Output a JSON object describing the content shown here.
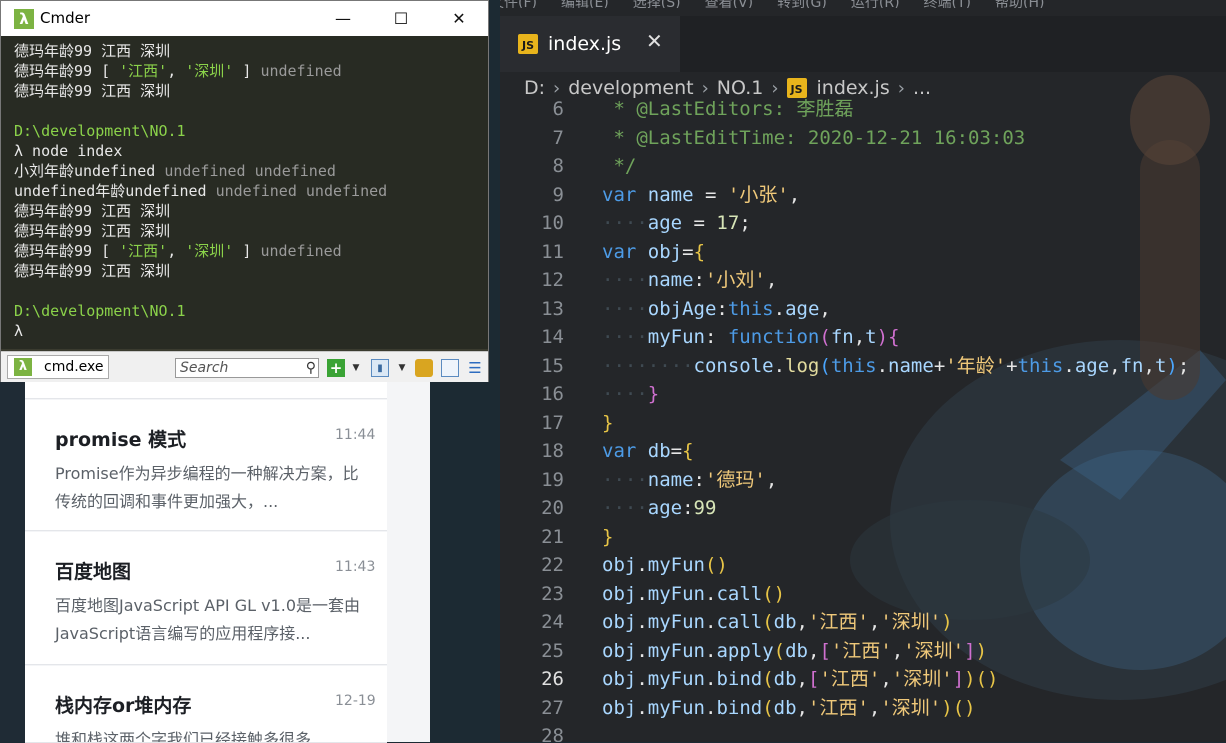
{
  "cmder": {
    "title": "Cmder",
    "minimize": "—",
    "maximize": "☐",
    "close": "✕",
    "tab_label": "cmd.exe",
    "search_placeholder": "Search",
    "console_lines": [
      [
        {
          "t": "德玛年龄99 江西 深圳",
          "c": ""
        }
      ],
      [
        {
          "t": "德玛年龄99 [ ",
          "c": ""
        },
        {
          "t": "'江西'",
          "c": "cg"
        },
        {
          "t": ", ",
          "c": ""
        },
        {
          "t": "'深圳'",
          "c": "cg"
        },
        {
          "t": " ] ",
          "c": ""
        },
        {
          "t": "undefined",
          "c": "cu"
        }
      ],
      [
        {
          "t": "德玛年龄99 江西 深圳",
          "c": ""
        }
      ],
      [
        {
          "t": "",
          "c": ""
        }
      ],
      [
        {
          "t": "D:\\development\\NO.1",
          "c": "cpath"
        }
      ],
      [
        {
          "t": "λ node index",
          "c": ""
        }
      ],
      [
        {
          "t": "小刘年龄undefined ",
          "c": ""
        },
        {
          "t": "undefined undefined",
          "c": "cu"
        }
      ],
      [
        {
          "t": "undefined年龄undefined ",
          "c": ""
        },
        {
          "t": "undefined undefined",
          "c": "cu"
        }
      ],
      [
        {
          "t": "德玛年龄99 江西 深圳",
          "c": ""
        }
      ],
      [
        {
          "t": "德玛年龄99 江西 深圳",
          "c": ""
        }
      ],
      [
        {
          "t": "德玛年龄99 [ ",
          "c": ""
        },
        {
          "t": "'江西'",
          "c": "cg"
        },
        {
          "t": ", ",
          "c": ""
        },
        {
          "t": "'深圳'",
          "c": "cg"
        },
        {
          "t": " ] ",
          "c": ""
        },
        {
          "t": "undefined",
          "c": "cu"
        }
      ],
      [
        {
          "t": "德玛年龄99 江西 深圳",
          "c": ""
        }
      ],
      [
        {
          "t": "",
          "c": ""
        }
      ],
      [
        {
          "t": "D:\\development\\NO.1",
          "c": "cpath"
        }
      ],
      [
        {
          "t": "λ",
          "c": ""
        }
      ]
    ]
  },
  "editor": {
    "tab": {
      "name": "index.js",
      "close": "✕",
      "icon": "JS"
    },
    "breadcrumb": [
      "D:",
      "development",
      "NO.1",
      "index.js",
      "..."
    ],
    "current_line": 26,
    "code_lines": [
      {
        "n": "6",
        "segs": [
          {
            "t": " * @LastEditors: 李胜磊",
            "c": "cm"
          }
        ]
      },
      {
        "n": "7",
        "segs": [
          {
            "t": " * @LastEditTime: 2020-12-21 16:03:03",
            "c": "cm"
          }
        ]
      },
      {
        "n": "8",
        "segs": [
          {
            "t": " */",
            "c": "cm"
          }
        ]
      },
      {
        "n": "9",
        "segs": [
          {
            "t": "var",
            "c": "kw"
          },
          {
            "t": " "
          },
          {
            "t": "name",
            "c": "vr"
          },
          {
            "t": " = "
          },
          {
            "t": "'小张'",
            "c": "str"
          },
          {
            "t": ","
          }
        ]
      },
      {
        "n": "10",
        "segs": [
          {
            "t": "····",
            "c": "guide"
          },
          {
            "t": "age",
            "c": "vr"
          },
          {
            "t": " = "
          },
          {
            "t": "17",
            "c": "num"
          },
          {
            "t": ";"
          }
        ]
      },
      {
        "n": "11",
        "segs": [
          {
            "t": "var",
            "c": "kw"
          },
          {
            "t": " "
          },
          {
            "t": "obj",
            "c": "vr"
          },
          {
            "t": "="
          },
          {
            "t": "{",
            "c": "br1"
          }
        ]
      },
      {
        "n": "12",
        "segs": [
          {
            "t": "····",
            "c": "guide"
          },
          {
            "t": "name",
            "c": "vr"
          },
          {
            "t": ":"
          },
          {
            "t": "'小刘'",
            "c": "str"
          },
          {
            "t": ","
          }
        ]
      },
      {
        "n": "13",
        "segs": [
          {
            "t": "····",
            "c": "guide"
          },
          {
            "t": "objAge",
            "c": "vr"
          },
          {
            "t": ":"
          },
          {
            "t": "this",
            "c": "kw"
          },
          {
            "t": "."
          },
          {
            "t": "age",
            "c": "vr"
          },
          {
            "t": ","
          }
        ]
      },
      {
        "n": "14",
        "segs": [
          {
            "t": "····",
            "c": "guide"
          },
          {
            "t": "myFun",
            "c": "vr"
          },
          {
            "t": ": "
          },
          {
            "t": "function",
            "c": "kw"
          },
          {
            "t": "(",
            "c": "br2"
          },
          {
            "t": "fn",
            "c": "vr"
          },
          {
            "t": ","
          },
          {
            "t": "t",
            "c": "vr"
          },
          {
            "t": ")",
            "c": "br2"
          },
          {
            "t": "{",
            "c": "br2"
          }
        ]
      },
      {
        "n": "15",
        "segs": [
          {
            "t": "········",
            "c": "guide"
          },
          {
            "t": "console",
            "c": "vr"
          },
          {
            "t": "."
          },
          {
            "t": "log",
            "c": "fn"
          },
          {
            "t": "(",
            "c": "br3"
          },
          {
            "t": "this",
            "c": "kw"
          },
          {
            "t": "."
          },
          {
            "t": "name",
            "c": "vr"
          },
          {
            "t": "+"
          },
          {
            "t": "'年龄'",
            "c": "str"
          },
          {
            "t": "+"
          },
          {
            "t": "this",
            "c": "kw"
          },
          {
            "t": "."
          },
          {
            "t": "age",
            "c": "vr"
          },
          {
            "t": ","
          },
          {
            "t": "fn",
            "c": "vr"
          },
          {
            "t": ","
          },
          {
            "t": "t",
            "c": "vr"
          },
          {
            "t": ")",
            "c": "br3"
          },
          {
            "t": ";"
          }
        ]
      },
      {
        "n": "16",
        "segs": [
          {
            "t": "····",
            "c": "guide"
          },
          {
            "t": "}",
            "c": "br2"
          }
        ]
      },
      {
        "n": "17",
        "segs": [
          {
            "t": "}",
            "c": "br1"
          }
        ]
      },
      {
        "n": "18",
        "segs": [
          {
            "t": "var",
            "c": "kw"
          },
          {
            "t": " "
          },
          {
            "t": "db",
            "c": "vr"
          },
          {
            "t": "="
          },
          {
            "t": "{",
            "c": "br1"
          }
        ]
      },
      {
        "n": "19",
        "segs": [
          {
            "t": "····",
            "c": "guide"
          },
          {
            "t": "name",
            "c": "vr"
          },
          {
            "t": ":"
          },
          {
            "t": "'德玛'",
            "c": "str"
          },
          {
            "t": ","
          }
        ]
      },
      {
        "n": "20",
        "segs": [
          {
            "t": "····",
            "c": "guide"
          },
          {
            "t": "age",
            "c": "vr"
          },
          {
            "t": ":"
          },
          {
            "t": "99",
            "c": "num"
          }
        ]
      },
      {
        "n": "21",
        "segs": [
          {
            "t": "}",
            "c": "br1"
          }
        ]
      },
      {
        "n": "22",
        "segs": [
          {
            "t": "obj",
            "c": "vr"
          },
          {
            "t": "."
          },
          {
            "t": "myFun",
            "c": "vr"
          },
          {
            "t": "()",
            "c": "br1"
          }
        ]
      },
      {
        "n": "23",
        "segs": [
          {
            "t": "obj",
            "c": "vr"
          },
          {
            "t": "."
          },
          {
            "t": "myFun",
            "c": "vr"
          },
          {
            "t": "."
          },
          {
            "t": "call",
            "c": "vr"
          },
          {
            "t": "()",
            "c": "br1"
          }
        ]
      },
      {
        "n": "24",
        "segs": [
          {
            "t": "obj",
            "c": "vr"
          },
          {
            "t": "."
          },
          {
            "t": "myFun",
            "c": "vr"
          },
          {
            "t": "."
          },
          {
            "t": "call",
            "c": "vr"
          },
          {
            "t": "(",
            "c": "br1"
          },
          {
            "t": "db",
            "c": "vr"
          },
          {
            "t": ","
          },
          {
            "t": "'江西'",
            "c": "str"
          },
          {
            "t": ","
          },
          {
            "t": "'深圳'",
            "c": "str"
          },
          {
            "t": ")",
            "c": "br1"
          }
        ]
      },
      {
        "n": "25",
        "segs": [
          {
            "t": "obj",
            "c": "vr"
          },
          {
            "t": "."
          },
          {
            "t": "myFun",
            "c": "vr"
          },
          {
            "t": "."
          },
          {
            "t": "apply",
            "c": "vr"
          },
          {
            "t": "(",
            "c": "br1"
          },
          {
            "t": "db",
            "c": "vr"
          },
          {
            "t": ","
          },
          {
            "t": "[",
            "c": "br2"
          },
          {
            "t": "'江西'",
            "c": "str"
          },
          {
            "t": ","
          },
          {
            "t": "'深圳'",
            "c": "str"
          },
          {
            "t": "]",
            "c": "br2"
          },
          {
            "t": ")",
            "c": "br1"
          }
        ]
      },
      {
        "n": "26",
        "segs": [
          {
            "t": "obj",
            "c": "vr"
          },
          {
            "t": "."
          },
          {
            "t": "myFun",
            "c": "vr"
          },
          {
            "t": "."
          },
          {
            "t": "bind",
            "c": "vr"
          },
          {
            "t": "(",
            "c": "br1"
          },
          {
            "t": "db",
            "c": "vr"
          },
          {
            "t": ","
          },
          {
            "t": "[",
            "c": "br2"
          },
          {
            "t": "'江西'",
            "c": "str"
          },
          {
            "t": ","
          },
          {
            "t": "'深圳'",
            "c": "str"
          },
          {
            "t": "]",
            "c": "br2"
          },
          {
            "t": ")",
            "c": "br1"
          },
          {
            "t": "()",
            "c": "br1"
          }
        ]
      },
      {
        "n": "27",
        "segs": [
          {
            "t": "obj",
            "c": "vr"
          },
          {
            "t": "."
          },
          {
            "t": "myFun",
            "c": "vr"
          },
          {
            "t": "."
          },
          {
            "t": "bind",
            "c": "vr"
          },
          {
            "t": "(",
            "c": "br1"
          },
          {
            "t": "db",
            "c": "vr"
          },
          {
            "t": ","
          },
          {
            "t": "'江西'",
            "c": "str"
          },
          {
            "t": ","
          },
          {
            "t": "'深圳'",
            "c": "str"
          },
          {
            "t": ")",
            "c": "br1"
          },
          {
            "t": "()",
            "c": "br1"
          }
        ]
      },
      {
        "n": "28",
        "segs": []
      }
    ]
  },
  "blog": {
    "cards": [
      {
        "title": "promise 模式",
        "time": "11:44",
        "excerpt": "Promise作为异步编程的一种解决方案，比传统的回调和事件更加强大，..."
      },
      {
        "title": "百度地图",
        "time": "11:43",
        "excerpt": "百度地图JavaScript API GL v1.0是一套由JavaScript语言编写的应用程序接..."
      },
      {
        "title": "栈内存or堆内存",
        "time": "12-19",
        "excerpt": "堆和栈这两个字我们已经接触多很多"
      }
    ]
  }
}
